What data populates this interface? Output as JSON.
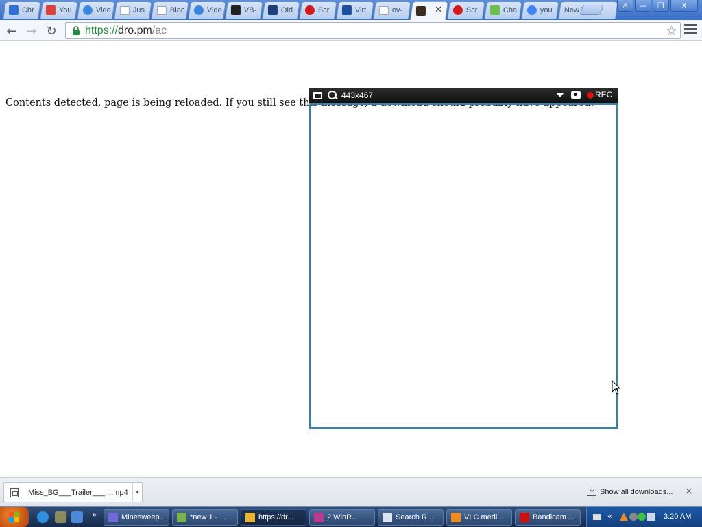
{
  "browser": {
    "tabs": [
      {
        "title": "Chr",
        "icon": "chrome-doc-icon",
        "color": "#2f6fd6"
      },
      {
        "title": "You",
        "icon": "download-red-icon",
        "color": "#e0403a"
      },
      {
        "title": "Vide",
        "icon": "blue-check-icon",
        "color": "#3b86e0"
      },
      {
        "title": "Jus",
        "icon": "page-icon",
        "color": "#ffffff"
      },
      {
        "title": "Bloc",
        "icon": "page-icon",
        "color": "#ffffff"
      },
      {
        "title": "Vide",
        "icon": "blue-check-icon",
        "color": "#3b86e0"
      },
      {
        "title": "VB-",
        "icon": "vb-icon",
        "color": "#222222"
      },
      {
        "title": "Old",
        "icon": "ov-icon",
        "color": "#1f3f7a"
      },
      {
        "title": "Scr",
        "icon": "red-circle-icon",
        "color": "#d41a1a"
      },
      {
        "title": "Virt",
        "icon": "virtualbox-icon",
        "color": "#1c4fa3"
      },
      {
        "title": "ov-",
        "icon": "page-icon",
        "color": "#ffffff"
      },
      {
        "title": "",
        "icon": "dark-site-icon",
        "color": "#3a2d1f",
        "active": true
      },
      {
        "title": "Scr",
        "icon": "red-circle-icon",
        "color": "#d41a1a"
      },
      {
        "title": "Cha",
        "icon": "music-green-icon",
        "color": "#6cc04a"
      },
      {
        "title": "you",
        "icon": "google-icon",
        "color": "#4285f4"
      },
      {
        "title": "New Ta",
        "icon": "",
        "color": ""
      }
    ],
    "url_scheme": "https://",
    "url_host": "dro.pm",
    "url_path": "/ac",
    "window_controls": {
      "user": "♙",
      "minimize": "—",
      "restore": "❐",
      "close": "X"
    }
  },
  "page": {
    "message_visible": "Contents detected, page is being reloaded. If you still see this me",
    "message_behind": "ssage, a download should probably have appeared."
  },
  "capture_tool": {
    "size_label": "443x467",
    "rec_label": "REC",
    "border_color": "#3f7f9f"
  },
  "downloads": {
    "file_name": "Miss_BG___Trailer___....mp4",
    "show_all_label": "Show all downloads...",
    "close_label": "×"
  },
  "taskbar": {
    "tasks": [
      {
        "label": "Minesweep...",
        "icon": "minesweeper-icon",
        "color": "#6f6ad8"
      },
      {
        "label": "*new 1 - ...",
        "icon": "notepad-icon",
        "color": "#7cb04a"
      },
      {
        "label": "https://dr...",
        "icon": "chrome-icon",
        "color": "#e8b52a",
        "active": true
      },
      {
        "label": "2 WinR...",
        "icon": "winrar-icon",
        "color": "#b93a8a"
      },
      {
        "label": "Search R...",
        "icon": "document-icon",
        "color": "#d9e4f2"
      },
      {
        "label": "VLC medi...",
        "icon": "vlc-icon",
        "color": "#f08a1c"
      },
      {
        "label": "Bandicam ...",
        "icon": "bandicam-icon",
        "color": "#cc1111"
      }
    ],
    "quicklaunch_more": "»",
    "tray_expand": "«",
    "clock": "3:20 AM"
  }
}
